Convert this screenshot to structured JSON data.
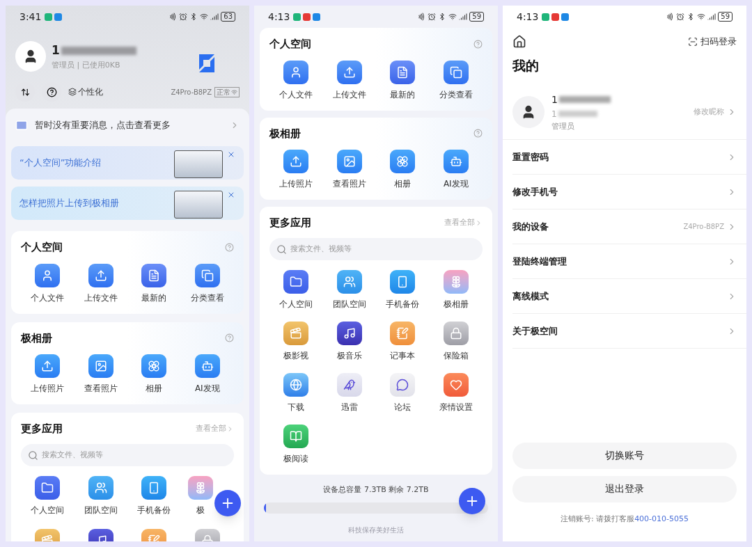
{
  "home": {
    "status": {
      "time": "3:41",
      "notifications": [
        {
          "color": "#1fb57a"
        },
        {
          "color": "#1e88e5"
        }
      ],
      "battery": "63"
    },
    "user": {
      "name": "1",
      "role": "管理员 | 已使用0KB"
    },
    "personalize": "个性化",
    "device": {
      "name": "Z4Pro-B8PZ",
      "state": "正常"
    },
    "notice": "暂时没有重要消息，点击查看更多",
    "banners": [
      {
        "text": "“个人空间”功能介绍"
      },
      {
        "text": "怎样把照片上传到极相册"
      }
    ],
    "sections": [
      {
        "title": "个人空间",
        "items": [
          "个人文件",
          "上传文件",
          "最新的",
          "分类查看"
        ]
      },
      {
        "title": "极相册",
        "items": [
          "上传照片",
          "查看照片",
          "相册",
          "AI发现"
        ]
      }
    ],
    "more": {
      "title": "更多应用",
      "link": "查看全部",
      "search": {
        "placeholder": "搜索文件、视频等"
      },
      "apps": [
        "个人空间",
        "团队空间",
        "手机备份",
        "极"
      ]
    }
  },
  "scrolled": {
    "status": {
      "time": "4:13",
      "notifications": [
        {
          "color": "#1fb57a"
        },
        {
          "color": "#e53935"
        },
        {
          "color": "#1e88e5"
        }
      ],
      "battery": "59"
    },
    "sections": [
      {
        "title": "个人空间",
        "items": [
          "个人文件",
          "上传文件",
          "最新的",
          "分类查看"
        ]
      },
      {
        "title": "极相册",
        "items": [
          "上传照片",
          "查看照片",
          "相册",
          "AI发现"
        ]
      }
    ],
    "more": {
      "title": "更多应用",
      "link": "查看全部",
      "search": {
        "placeholder": "搜索文件、视频等"
      },
      "apps": [
        "个人空间",
        "团队空间",
        "手机备份",
        "极相册",
        "极影视",
        "极音乐",
        "记事本",
        "保险箱",
        "下载",
        "迅雷",
        "论坛",
        "亲情设置",
        "极阅读"
      ]
    },
    "capacity": "设备总容量 7.3TB 剩余 7.2TB",
    "usage": {
      "level": 0.01
    },
    "slogan": "科技保存美好生活"
  },
  "profile": {
    "status": {
      "time": "4:13",
      "notifications": [
        {
          "color": "#1fb57a"
        },
        {
          "color": "#e53935"
        },
        {
          "color": "#1e88e5"
        }
      ],
      "battery": "59"
    },
    "scan": "扫码登录",
    "title": "我的",
    "user": {
      "name": "1",
      "phone": "1",
      "role": "管理员",
      "edit": "修改昵称"
    },
    "menu": [
      {
        "label": "重置密码"
      },
      {
        "label": "修改手机号"
      },
      {
        "label": "我的设备",
        "value": "Z4Pro-B8PZ"
      },
      {
        "label": "登陆终端管理"
      },
      {
        "label": "离线模式"
      },
      {
        "label": "关于极空间"
      }
    ],
    "buttons": [
      "切换账号",
      "退出登录"
    ],
    "footer": {
      "text": "注销账号: 请拨打客服",
      "link": "400-010-5055"
    }
  }
}
